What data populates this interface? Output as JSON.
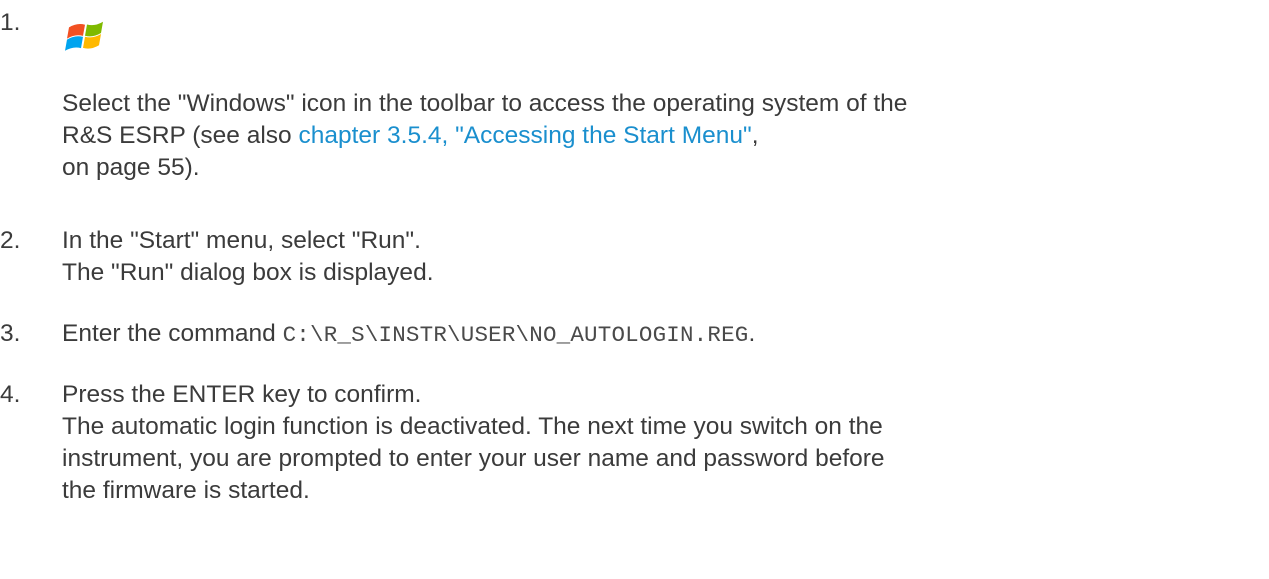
{
  "steps": [
    {
      "number": "1.",
      "icon": "windows-logo-icon",
      "lines": {
        "l1": "Select the \"Windows\" icon in the toolbar to access the operating system of the",
        "l2_pre": "R&S ESRP (see also ",
        "l2_link": "chapter 3.5.4, \"Accessing the Start Menu\"",
        "l2_post": ",",
        "l3": "on page 55)."
      }
    },
    {
      "number": "2.",
      "lines": {
        "l1": "In the \"Start\" menu, select \"Run\".",
        "l2": "The \"Run\" dialog box is displayed."
      }
    },
    {
      "number": "3.",
      "lines": {
        "l1_pre": "Enter the command ",
        "l1_code": "C:\\R_S\\INSTR\\USER\\NO_AUTOLOGIN.REG",
        "l1_post": "."
      }
    },
    {
      "number": "4.",
      "lines": {
        "l1": "Press the ENTER key to confirm.",
        "l2": "The automatic login function is deactivated. The next time you switch on the",
        "l3": "instrument, you are prompted to enter your user name and password before",
        "l4": "the firmware is started."
      }
    }
  ],
  "colors": {
    "text": "#3b3b3b",
    "link": "#1a8fce"
  }
}
